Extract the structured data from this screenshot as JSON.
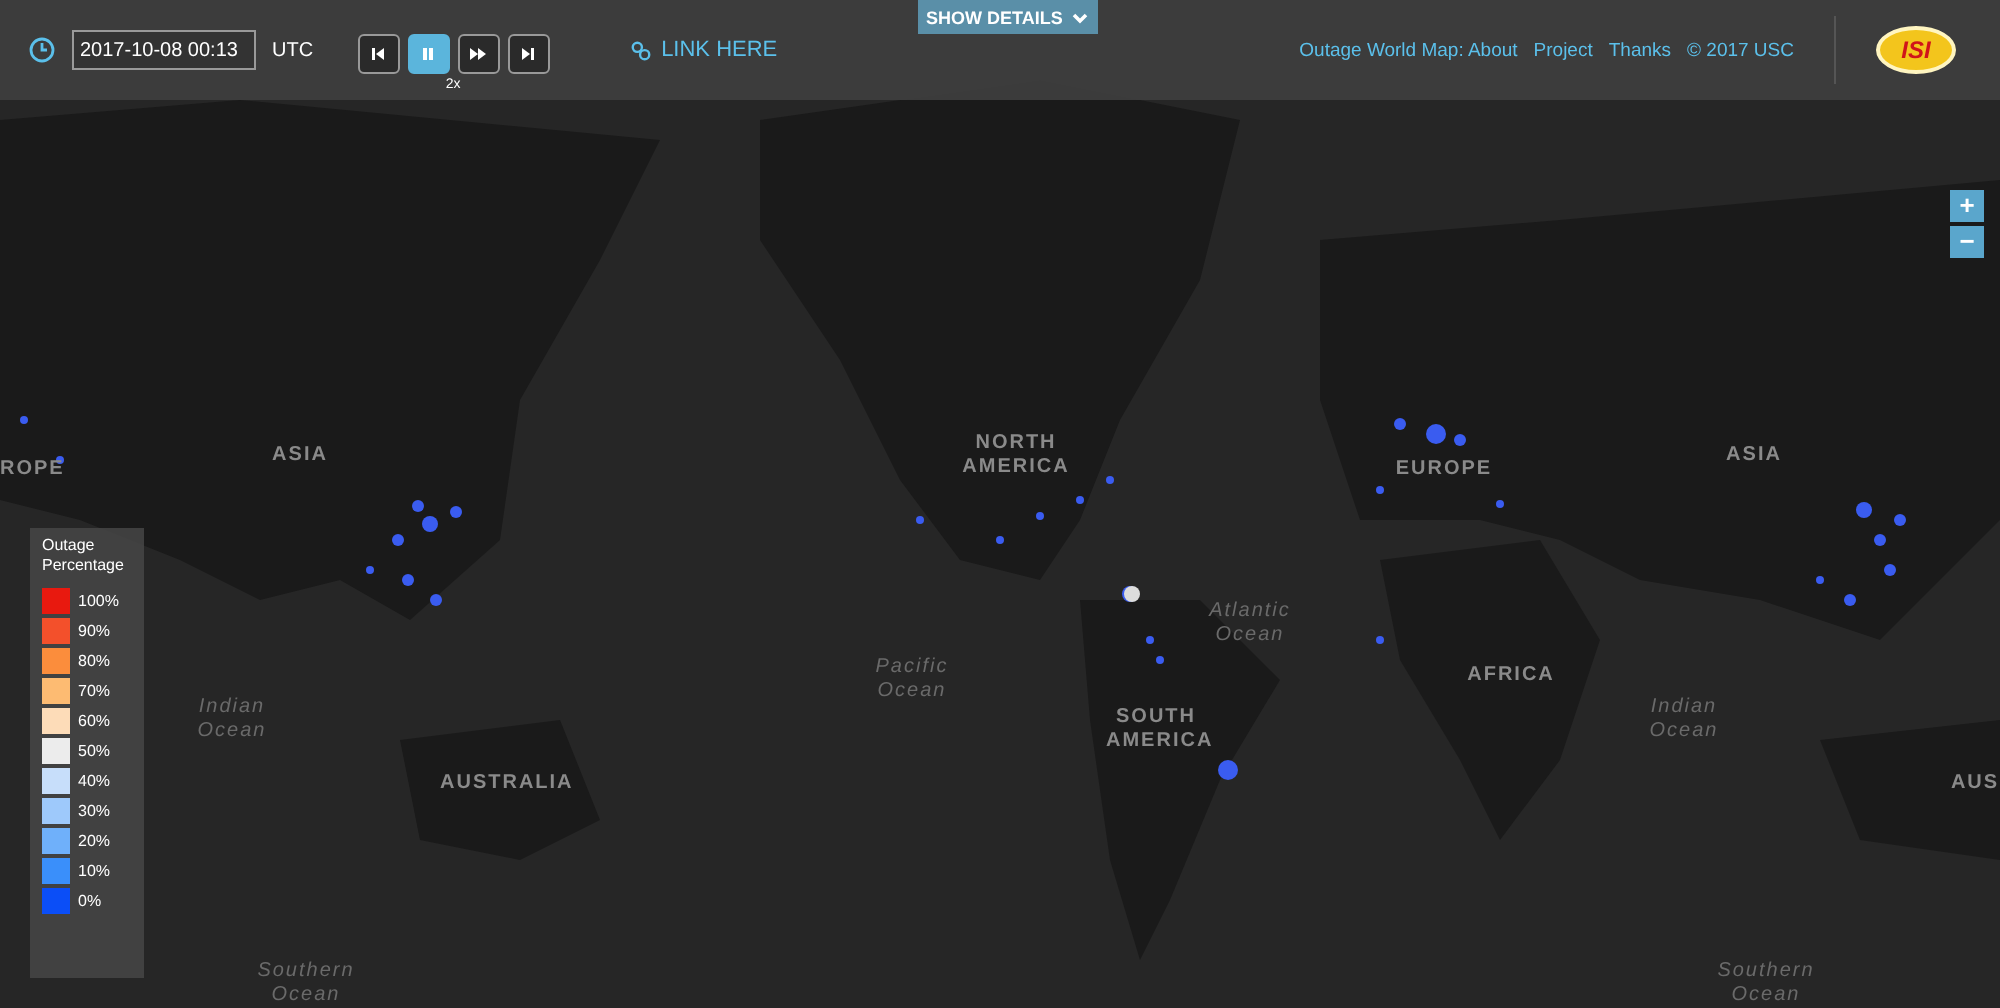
{
  "toolbar": {
    "datetime": "2017-10-08 00:13",
    "timezone": "UTC",
    "playback": [
      {
        "kind": "first",
        "selected": false
      },
      {
        "kind": "pause",
        "selected": true
      },
      {
        "kind": "fast",
        "selected": false
      },
      {
        "kind": "last",
        "selected": false
      }
    ],
    "speed": "2x",
    "link": "LINK HERE",
    "details_button": "SHOW DETAILS",
    "nav_links": [
      "Outage World Map: About",
      "Project",
      "Thanks"
    ],
    "copyright": "© 2017 USC",
    "logo": "ISI"
  },
  "zoom_controls": [
    "+",
    "−"
  ],
  "map_labels": [
    {
      "text": "ROPE",
      "kind": "land"
    },
    {
      "text": "ASIA",
      "kind": "land"
    },
    {
      "text": "NORTH AMERICA",
      "kind": "land"
    },
    {
      "text": "EUROPE",
      "kind": "land"
    },
    {
      "text": "ASIA",
      "kind": "land"
    },
    {
      "text": "Atlantic Ocean",
      "kind": "ocean"
    },
    {
      "text": "Pacific Ocean",
      "kind": "ocean"
    },
    {
      "text": "Indian Ocean",
      "kind": "ocean"
    },
    {
      "text": "AFRICA",
      "kind": "land"
    },
    {
      "text": "Indian Ocean",
      "kind": "ocean"
    },
    {
      "text": "SOUTH AMERICA",
      "kind": "land"
    },
    {
      "text": "AUSTRALIA",
      "kind": "land"
    },
    {
      "text": "AUS",
      "kind": "land"
    },
    {
      "text": "Southern Ocean",
      "kind": "ocean"
    },
    {
      "text": "Southern Ocean",
      "kind": "ocean"
    }
  ],
  "legend": {
    "title": "Outage Percentage",
    "items": [
      {
        "label": "100%",
        "color": "#e8190f"
      },
      {
        "label": "90%",
        "color": "#f3502b"
      },
      {
        "label": "80%",
        "color": "#fb8d3c"
      },
      {
        "label": "70%",
        "color": "#fdbb72"
      },
      {
        "label": "60%",
        "color": "#fddcb8"
      },
      {
        "label": "50%",
        "color": "#ececec"
      },
      {
        "label": "40%",
        "color": "#c7defa"
      },
      {
        "label": "30%",
        "color": "#9ec9fb"
      },
      {
        "label": "20%",
        "color": "#6fb0fa"
      },
      {
        "label": "10%",
        "color": "#3a8ffa"
      },
      {
        "label": "0%",
        "color": "#0b4ef7"
      }
    ]
  }
}
